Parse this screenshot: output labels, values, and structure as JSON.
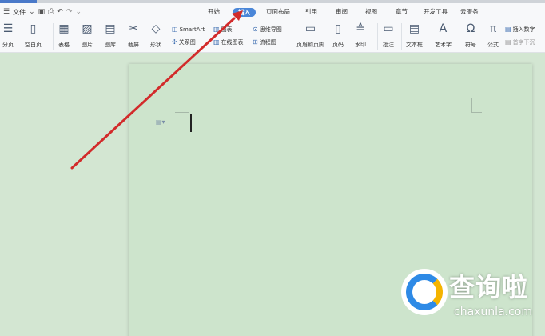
{
  "quick_access": {
    "file_label": "文件"
  },
  "tabs": [
    {
      "label": "开始"
    },
    {
      "label": "插入"
    },
    {
      "label": "页面布局"
    },
    {
      "label": "引用"
    },
    {
      "label": "审阅"
    },
    {
      "label": "视图"
    },
    {
      "label": "章节"
    },
    {
      "label": "开发工具"
    },
    {
      "label": "云服务"
    }
  ],
  "toolbar": {
    "page_break": "分页",
    "blank_page": "空白页",
    "table": "表格",
    "picture": "图片",
    "gallery": "图库",
    "screenshot": "截屏",
    "shape": "形状",
    "smartart": "SmartArt",
    "relation": "关系图",
    "chart": "图表",
    "online_chart": "在线图表",
    "mindmap": "思维导图",
    "flowchart": "流程图",
    "header_footer": "页眉和页脚",
    "page_number": "页码",
    "watermark": "水印",
    "comment": "批注",
    "textbox": "文本框",
    "wordart": "艺术字",
    "symbol": "符号",
    "formula": "公式",
    "insert_number": "插入数字",
    "first_letter": "首字下沉"
  },
  "watermark_brand": {
    "name": "查询啦",
    "url": "chaxunla.com"
  },
  "colors": {
    "accent": "#4a86d8",
    "document_bg": "#cde4cc",
    "workspace_bg": "#d3e6d2",
    "arrow": "#d22b2b"
  }
}
